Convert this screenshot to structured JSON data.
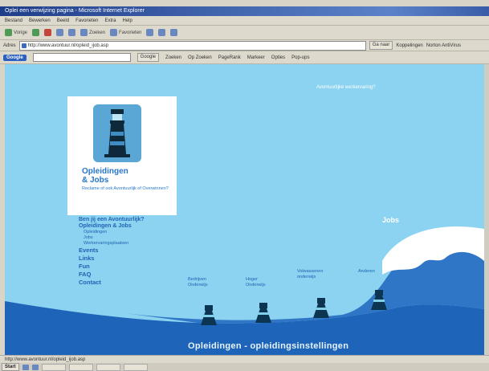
{
  "window": {
    "title": "Oplei een verwijzing pagina - Microsoft Internet Explorer"
  },
  "menubar": {
    "items": [
      "Bestand",
      "Bewerken",
      "Beeld",
      "Favorieten",
      "Extra",
      "Help"
    ]
  },
  "toolbar": {
    "back_label": "Vorige",
    "forward_label": "",
    "stop_label": "",
    "refresh_label": "",
    "home_label": "",
    "search_label": "Zoeken",
    "favorites_label": "Favorieten",
    "media_label": ""
  },
  "addressbar": {
    "label": "Adres",
    "value": "http://www.avontuur.nl/opleid_ijob.asp",
    "go_label": "Ga naar",
    "links_label": "Koppelingen",
    "extra_label": "Norton AntiVirus"
  },
  "linksbar": {
    "google_label": "Google",
    "search_btn": "Google",
    "items": [
      "Zoeken",
      "Op Zoeken",
      "PageRank",
      "Markeer",
      "Opties",
      "Pop-ups"
    ]
  },
  "page": {
    "top_link": "Avontuurlijke werkervaring?",
    "logo_title_line1": "Opleidingen",
    "logo_title_line2": "& Jobs",
    "logo_subtitle": "Reclame of ook Avontuurlijk of Overwinnen?",
    "nav": {
      "item1": "Ben jij een Avontuurlijk?",
      "item2": "Opleidingen & Jobs",
      "sub1": "Opleidingen",
      "sub2": "Jobs",
      "sub3": "Werkervaringsplaatsen",
      "item3": "Events",
      "item4": "Links",
      "item5": "Fun",
      "item6": "FAQ",
      "item7": "Contact"
    },
    "jobs_label": "Jobs",
    "harbors": [
      {
        "label": "Bedrijven Onderwijs"
      },
      {
        "label": "Hoger Onderwijs"
      },
      {
        "label": "Volwassenen onderwijs"
      },
      {
        "label": "Anderen"
      }
    ],
    "footer_title": "Opleidingen - opleidingsinstellingen"
  },
  "statusbar": {
    "text": "http://www.avontuur.nl/opleid_ijob.asp"
  },
  "taskbar": {
    "start_label": "Start"
  },
  "colors": {
    "sky": "#8bd3f0",
    "sea_dark": "#1e64b8",
    "sea_wave": "#2f76c6",
    "link_blue": "#1f63b5",
    "logo_blue": "#2677c9"
  }
}
